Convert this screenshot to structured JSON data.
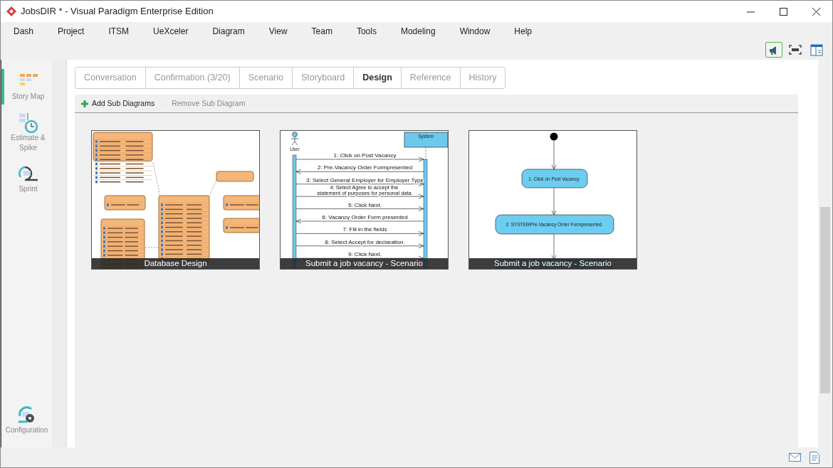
{
  "window": {
    "title": "JobsDIR * - Visual Paradigm Enterprise Edition"
  },
  "menu": [
    "Dash",
    "Project",
    "ITSM",
    "UeXceler",
    "Diagram",
    "View",
    "Team",
    "Tools",
    "Modeling",
    "Window",
    "Help"
  ],
  "toolbar": [
    {
      "kind": "megaphone",
      "selected": true
    },
    {
      "kind": "frame",
      "selected": false
    },
    {
      "kind": "panel",
      "selected": false
    }
  ],
  "sidebar": {
    "items": [
      {
        "label": "Story Map",
        "kind": "storymap",
        "selected": true
      },
      {
        "label": "Estimate & Spike",
        "kind": "estimate",
        "selected": false
      },
      {
        "label": "Sprint",
        "kind": "sprint",
        "selected": false
      }
    ],
    "footer": {
      "label": "Configuration"
    }
  },
  "tabs": [
    {
      "label": "Conversation",
      "selected": false
    },
    {
      "label": "Confirmation (3/20)",
      "selected": false
    },
    {
      "label": "Scenario",
      "selected": false
    },
    {
      "label": "Storyboard",
      "selected": false
    },
    {
      "label": "Design",
      "selected": true
    },
    {
      "label": "Reference",
      "selected": false
    },
    {
      "label": "History",
      "selected": false
    }
  ],
  "actions": [
    {
      "label": "Add Sub Diagrams",
      "disabled": false
    },
    {
      "label": "Remove Sub Diagram",
      "disabled": true
    }
  ],
  "diagrams": [
    {
      "kind": "erd",
      "caption": "Database Design"
    },
    {
      "kind": "sequence",
      "caption": "Submit a job vacancy - Scenario",
      "lifelines": [
        "User",
        "System"
      ],
      "messages": [
        {
          "text": "1: Click on Post Vacancy",
          "reply": false
        },
        {
          "text": "2: Pre-Vacancy Order Formpresented",
          "reply": true
        },
        {
          "text": "3: Select General Employer for Employer Type",
          "reply": false
        },
        {
          "text": "4: Select Agree to accept the statement of purposes for personal data.",
          "reply": false
        },
        {
          "text": "5: Click Next.",
          "reply": false
        },
        {
          "text": "6: Vacancy Order Form presented",
          "reply": true
        },
        {
          "text": "7: Fill in the fields",
          "reply": false
        },
        {
          "text": "8: Select Accept for declaration.",
          "reply": false
        },
        {
          "text": "9: Click Next.",
          "reply": false
        }
      ]
    },
    {
      "kind": "activity",
      "caption": "Submit a job vacancy - Scenario",
      "nodes": [
        "1. Click on Post Vacancy",
        "2. SYSTEMPre-Vacancy Order Formpresented"
      ]
    }
  ]
}
